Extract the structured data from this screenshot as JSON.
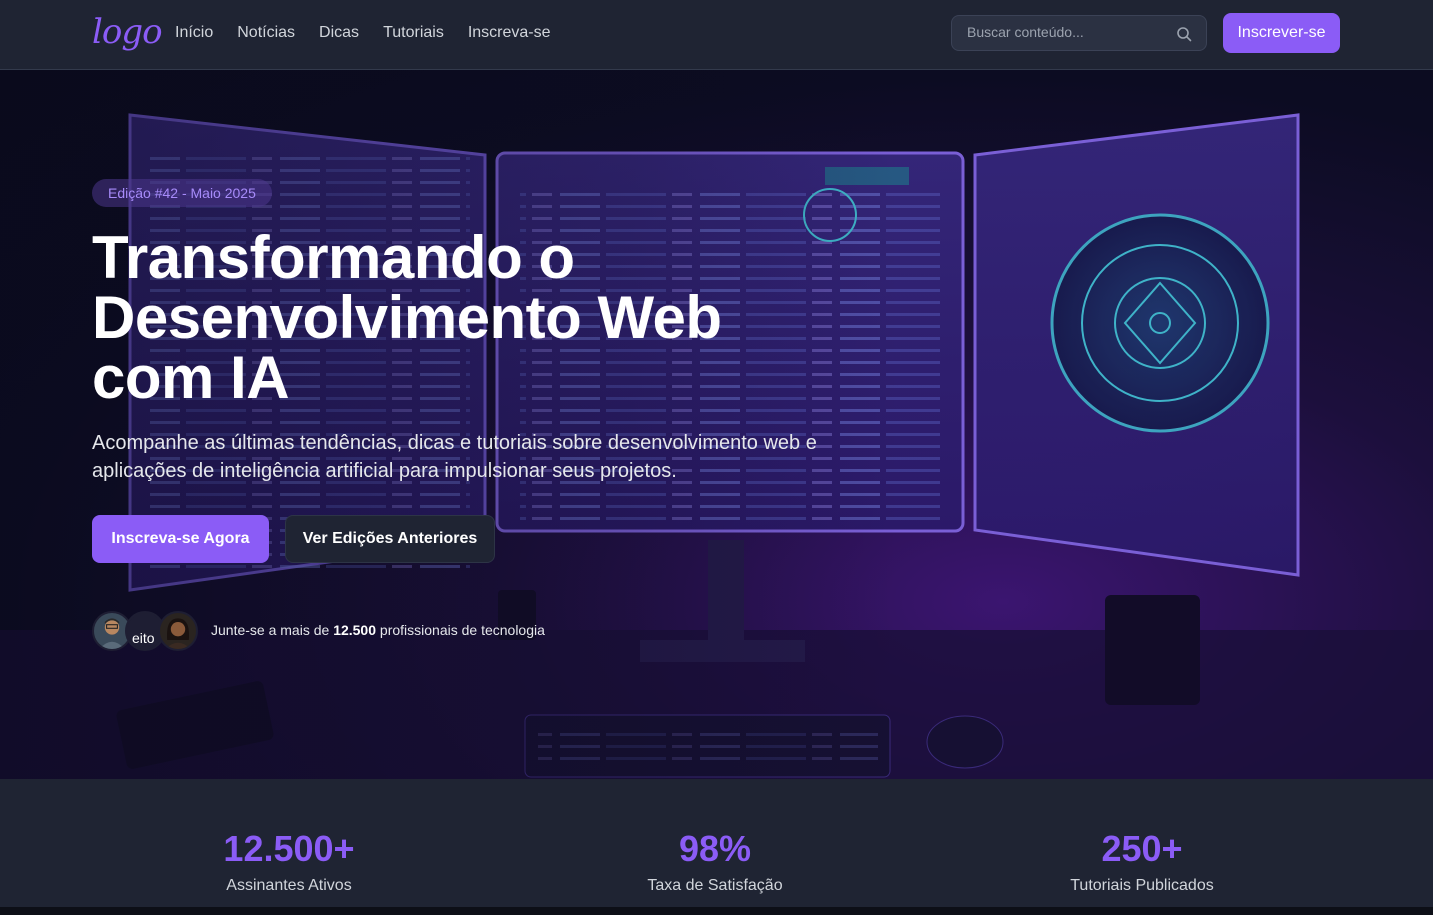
{
  "nav": {
    "logo": "logo",
    "links": [
      "Início",
      "Notícias",
      "Dicas",
      "Tutoriais",
      "Inscreva-se"
    ],
    "search_placeholder": "Buscar conteúdo...",
    "cta": "Inscrever-se"
  },
  "hero": {
    "badge": "Edição #42 - Maio 2025",
    "title": "Transformando o Desenvolvimento Web com IA",
    "subtitle": "Acompanhe as últimas tendências, dicas e tutoriais sobre desenvolvimento web e aplicações de inteligência artificial para impulsionar seus projetos.",
    "primary_button": "Inscreva-se Agora",
    "secondary_button": "Ver Edições Anteriores",
    "social_prefix": "Junte-se a mais de",
    "social_count": "12.500",
    "social_suffix": "profissionais de tecnologia",
    "broken_avatar_alt": "eito"
  },
  "stats": [
    {
      "value": "12.500+",
      "label": "Assinantes Ativos"
    },
    {
      "value": "98%",
      "label": "Taxa de Satisfação"
    },
    {
      "value": "250+",
      "label": "Tutoriais Publicados"
    }
  ],
  "colors": {
    "accent": "#8b5cf6",
    "nav_bg": "#1f2433",
    "hero_glow": "#3b1570"
  },
  "icons": [
    "search-icon"
  ]
}
